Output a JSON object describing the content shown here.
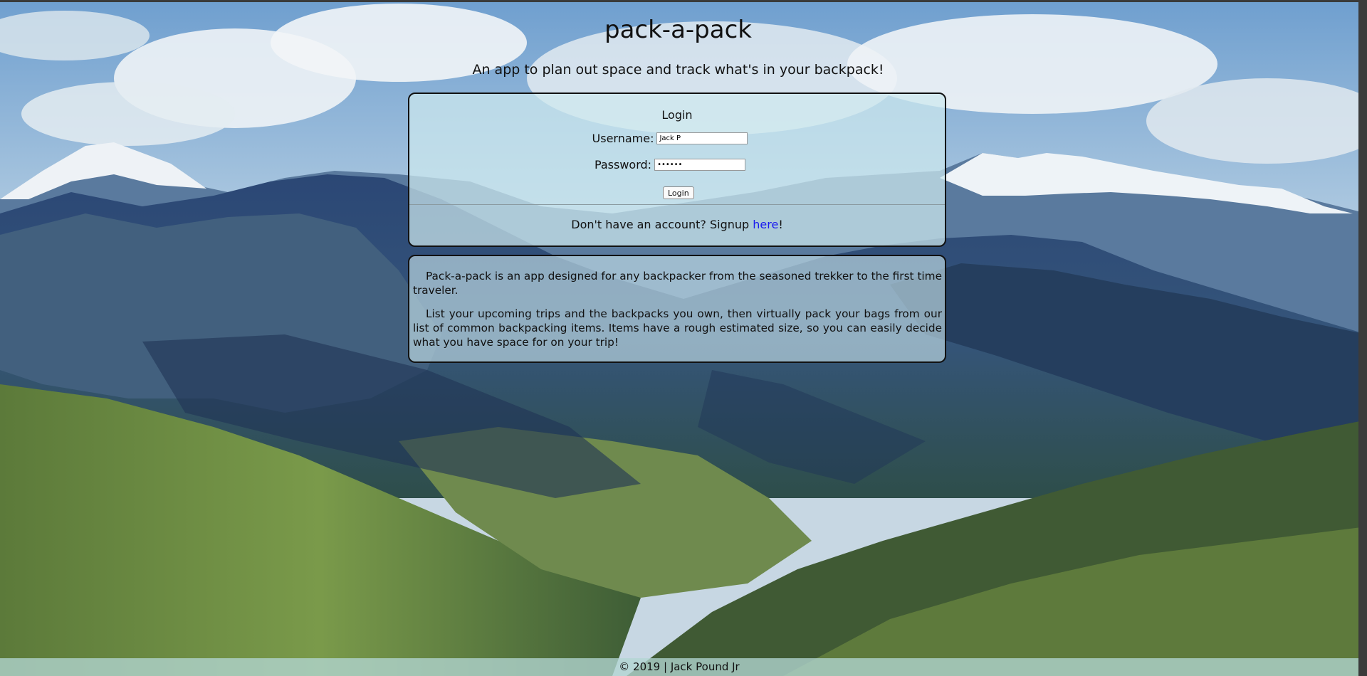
{
  "header": {
    "title": "pack-a-pack",
    "tagline": "An app to plan out space and track what's in your backpack!"
  },
  "login": {
    "title": "Login",
    "username_label": "Username:",
    "username_value": "Jack P",
    "password_label": "Password:",
    "password_value": "••••••",
    "button_label": "Login",
    "signup_prefix": "Don't have an account? Signup ",
    "signup_link": "here",
    "signup_suffix": "!"
  },
  "about": {
    "paragraphs": [
      "Pack-a-pack is an app designed for any backpacker from the seasoned trekker to the first time traveler.",
      "List your upcoming trips and the backpacks you own, then virtually pack your bags from our list of common backpacking items. Items have a rough estimated size, so you can easily decide what you have space for on your trip!"
    ]
  },
  "footer": {
    "text": "© 2019 | Jack Pound Jr"
  },
  "colors": {
    "link": "#1a1aee",
    "panel_border": "#111111"
  }
}
